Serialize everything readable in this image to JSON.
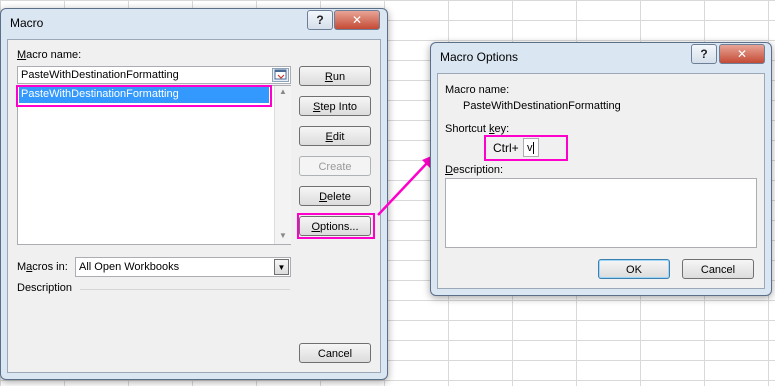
{
  "macro_dialog": {
    "title": "Macro",
    "help_btn": "?",
    "close_btn": "✕",
    "macro_name_label": "Macro name:",
    "macro_name_value": "PasteWithDestinationFormatting",
    "macro_list": [
      "PasteWithDestinationFormatting"
    ],
    "buttons": {
      "run": "Run",
      "step_into": "Step Into",
      "edit": "Edit",
      "create": "Create",
      "delete": "Delete",
      "options": "Options...",
      "cancel": "Cancel"
    },
    "macros_in_label": "Macros in:",
    "macros_in_value": "All Open Workbooks",
    "description_label": "Description"
  },
  "options_dialog": {
    "title": "Macro Options",
    "help_btn": "?",
    "close_btn": "✕",
    "macro_name_label": "Macro name:",
    "macro_name_value": "PasteWithDestinationFormatting",
    "shortcut_label": "Shortcut key:",
    "ctrl_label": "Ctrl+",
    "shortcut_value": "v",
    "description_label": "Description:",
    "ok": "OK",
    "cancel": "Cancel"
  },
  "colors": {
    "highlight": "#ff00cc",
    "selection": "#3399ff"
  }
}
